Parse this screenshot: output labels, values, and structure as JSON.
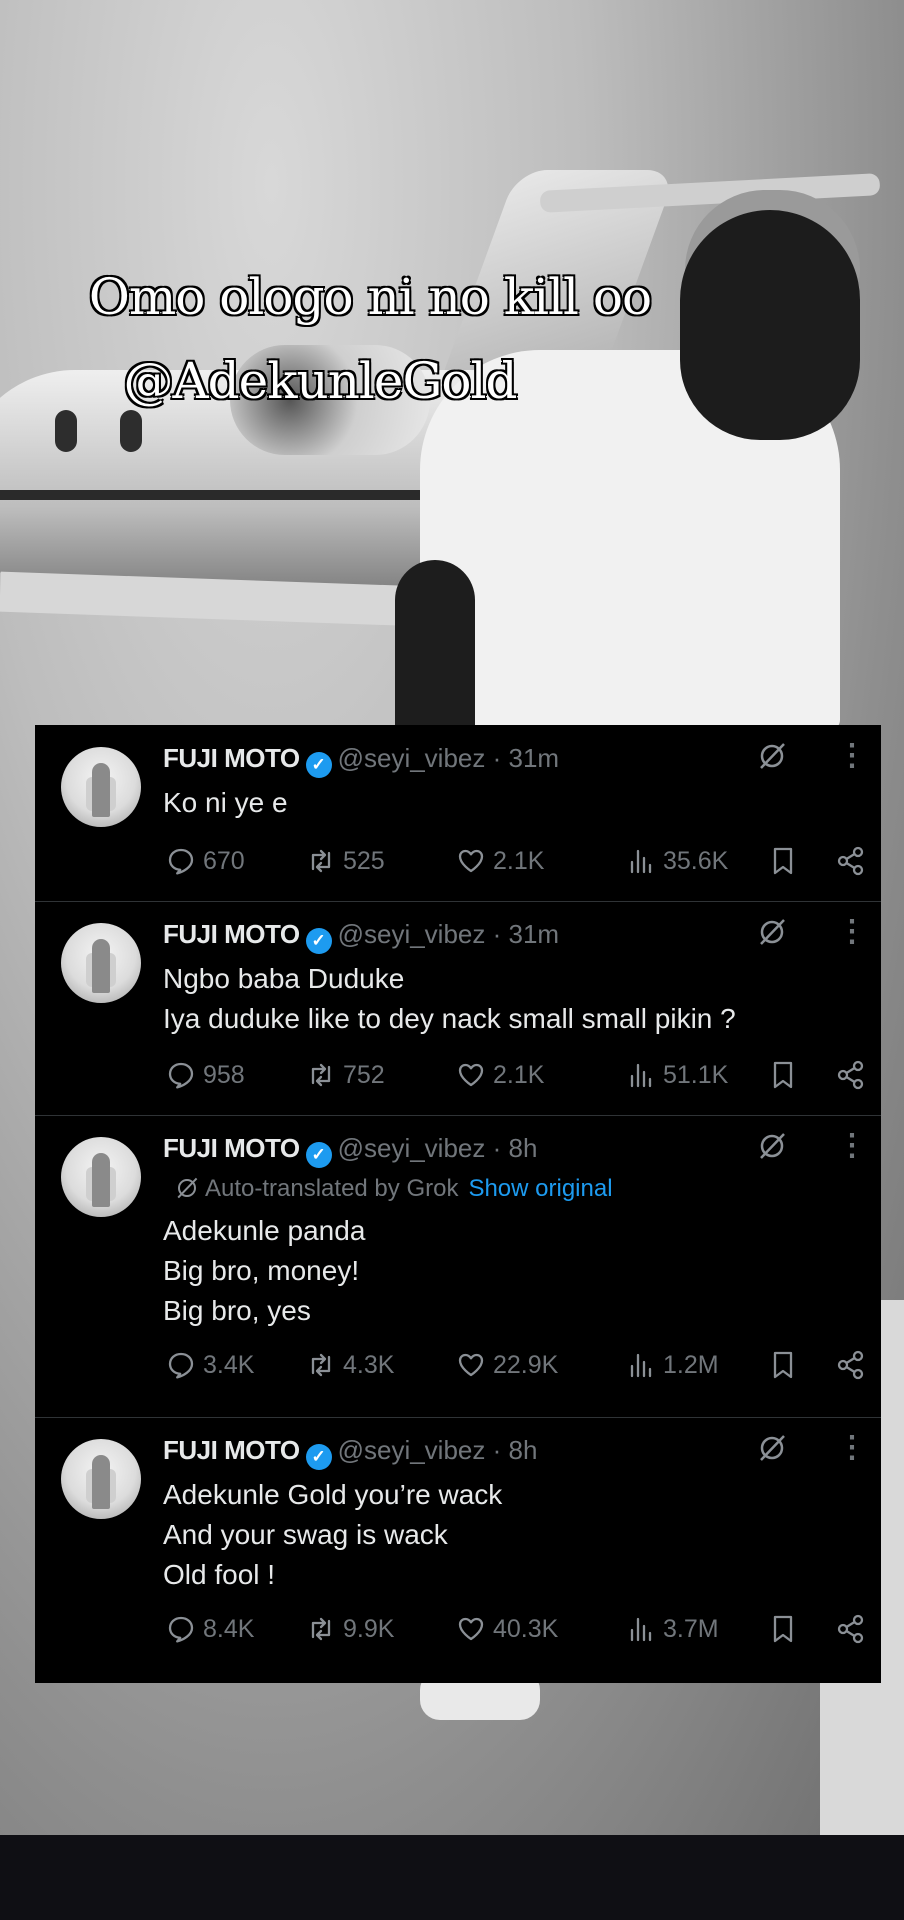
{
  "caption": {
    "line1": "Omo ologo ni no kill oo",
    "line2": "@AdekunleGold"
  },
  "tweets": [
    {
      "name": "FUJI MOTO",
      "handle": "@seyi_vibez · 31m",
      "lines": [
        "Ko ni ye e"
      ],
      "replies": "670",
      "reposts": "525",
      "likes": "2.1K",
      "views": "35.6K"
    },
    {
      "name": "FUJI MOTO",
      "handle": "@seyi_vibez · 31m",
      "lines": [
        "Ngbo baba Duduke",
        "Iya duduke like to dey nack small small pikin ?"
      ],
      "replies": "958",
      "reposts": "752",
      "likes": "2.1K",
      "views": "51.1K"
    },
    {
      "name": "FUJI MOTO",
      "handle": "@seyi_vibez · 8h",
      "translated_label": "Auto-translated by Grok",
      "show_original": "Show original",
      "lines": [
        "Adekunle panda",
        "Big bro, money!",
        "Big bro, yes"
      ],
      "replies": "3.4K",
      "reposts": "4.3K",
      "likes": "22.9K",
      "views": "1.2M"
    },
    {
      "name": "FUJI MOTO",
      "handle": "@seyi_vibez · 8h",
      "lines": [
        "Adekunle Gold you’re wack",
        "And your swag is wack",
        "Old fool !"
      ],
      "replies": "8.4K",
      "reposts": "9.9K",
      "likes": "40.3K",
      "views": "3.7M"
    }
  ],
  "colors": {
    "panel": "#000000",
    "text": "#e7e9ea",
    "muted": "#71767b",
    "accent": "#1d9bf0"
  },
  "icons": [
    "grok-icon",
    "more-icon",
    "verified-badge-icon",
    "reply-icon",
    "repost-icon",
    "like-icon",
    "views-icon",
    "bookmark-icon",
    "share-icon"
  ]
}
